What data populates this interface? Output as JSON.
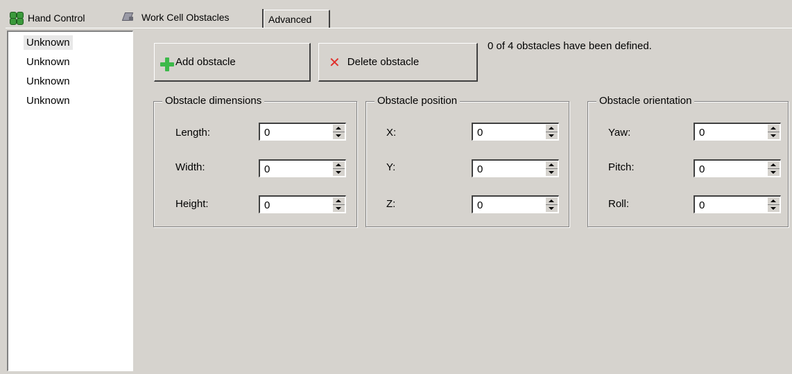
{
  "tabs": [
    {
      "label": "Hand Control",
      "icon": "hand-control-icon"
    },
    {
      "label": "Work Cell Obstacles",
      "icon": "work-cell-icon",
      "active": true
    },
    {
      "label": "Advanced"
    }
  ],
  "obstacle_list": [
    "Unknown",
    "Unknown",
    "Unknown",
    "Unknown"
  ],
  "buttons": {
    "add": "Add obstacle",
    "delete": "Delete obstacle"
  },
  "status": "0 of 4 obstacles have been defined.",
  "groups": {
    "dimensions": {
      "title": "Obstacle dimensions",
      "fields": [
        {
          "label": "Length:",
          "value": "0"
        },
        {
          "label": "Width:",
          "value": "0"
        },
        {
          "label": "Height:",
          "value": "0"
        }
      ]
    },
    "position": {
      "title": "Obstacle position",
      "fields": [
        {
          "label": "X:",
          "value": "0"
        },
        {
          "label": "Y:",
          "value": "0"
        },
        {
          "label": "Z:",
          "value": "0"
        }
      ]
    },
    "orientation": {
      "title": "Obstacle orientation",
      "fields": [
        {
          "label": "Yaw:",
          "value": "0"
        },
        {
          "label": "Pitch:",
          "value": "0"
        },
        {
          "label": "Roll:",
          "value": "0"
        }
      ]
    }
  },
  "colors": {
    "background": "#d6d3ce",
    "add_icon": "#3db94a",
    "delete_icon": "#e0302c"
  }
}
